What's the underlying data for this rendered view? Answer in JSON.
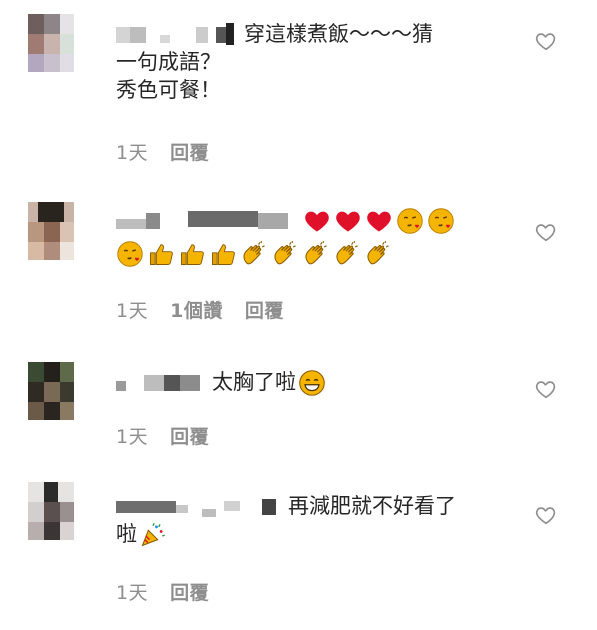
{
  "comments": [
    {
      "text_lines": [
        "穿這樣煮飯～～～猜",
        "一句成語？",
        "秀色可餐！"
      ],
      "time": "1天",
      "likes": "",
      "reply_label": "回覆"
    },
    {
      "emojis_row1": [
        "red-heart",
        "red-heart",
        "red-heart",
        "face-blowing-kiss",
        "face-blowing-kiss"
      ],
      "emojis_row2": [
        "face-blowing-kiss",
        "thumbs-up",
        "thumbs-up",
        "thumbs-up",
        "clapping-hands",
        "clapping-hands",
        "clapping-hands",
        "clapping-hands",
        "clapping-hands"
      ],
      "time": "1天",
      "likes": "1個讚",
      "reply_label": "回覆"
    },
    {
      "text": "太胸了啦",
      "emoji": "grinning-face",
      "time": "1天",
      "likes": "",
      "reply_label": "回覆"
    },
    {
      "text_line1": "再減肥就不好看了",
      "text_line2": "啦",
      "emoji": "party-popper",
      "time": "1天",
      "likes": "",
      "reply_label": "回覆"
    }
  ],
  "colors": {
    "meta_text": "#8e8e8e",
    "body_text": "#262626",
    "heart_outline": "#8e8e8e",
    "emoji_heart": "#e0102a",
    "emoji_yellow": "#f5b400"
  }
}
